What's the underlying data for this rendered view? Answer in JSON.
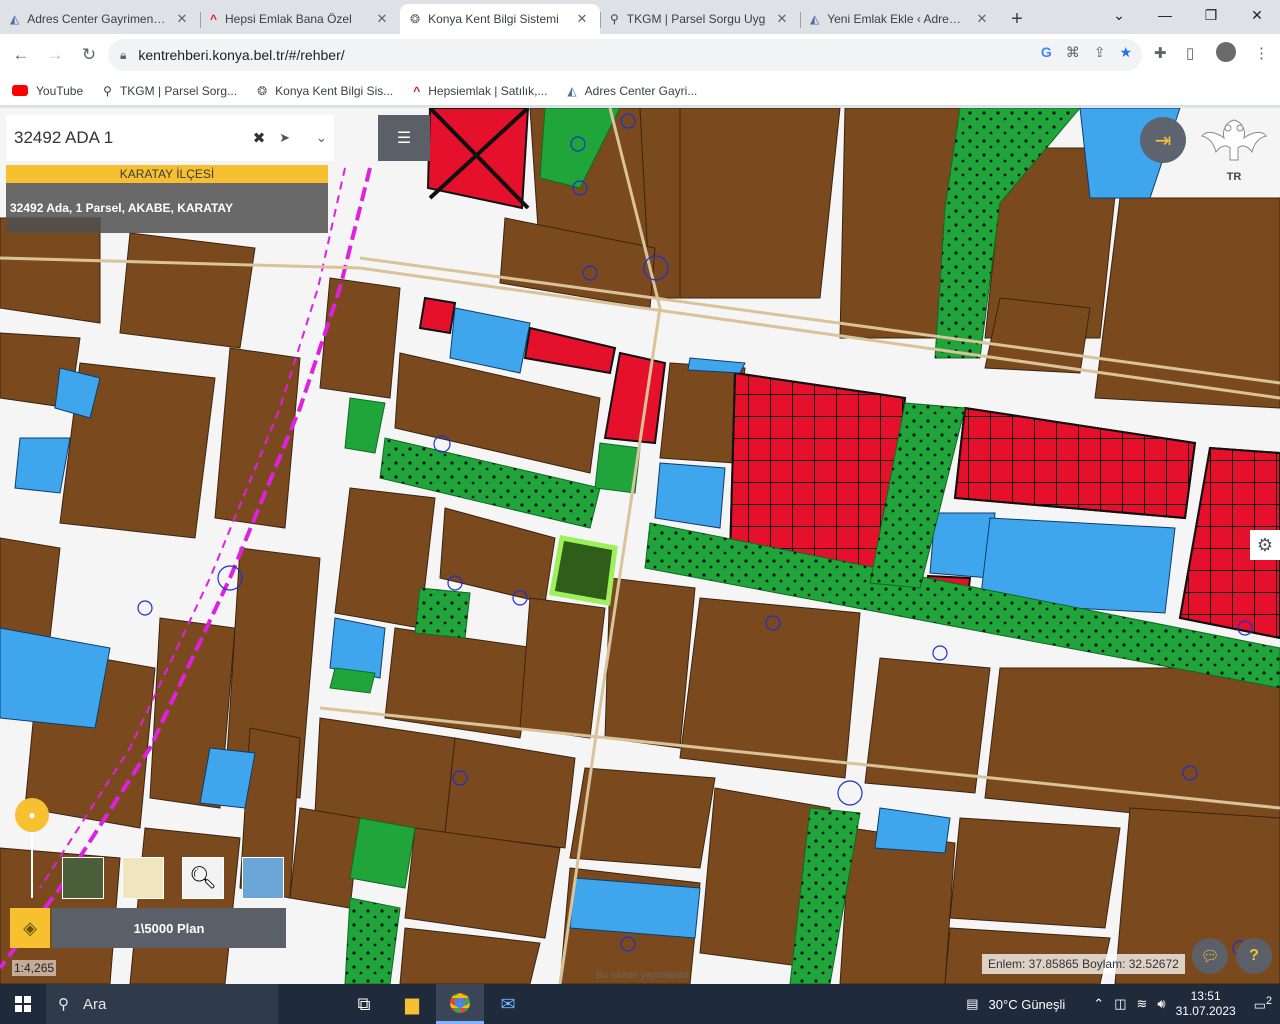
{
  "browser": {
    "tabs": [
      {
        "title": "Adres Center Gayrimenkul",
        "icon": "adres-logo-icon",
        "active": false
      },
      {
        "title": "Hepsi Emlak Bana Özel",
        "icon": "hepsiemlak-icon",
        "active": false
      },
      {
        "title": "Konya Kent Bilgi Sistemi",
        "icon": "konya-logo-icon",
        "active": true
      },
      {
        "title": "TKGM | Parsel Sorgu Uyg",
        "icon": "map-pin-icon",
        "active": false
      },
      {
        "title": "Yeni Emlak Ekle ‹ Adres Ce",
        "icon": "adres-logo-icon",
        "active": false
      }
    ],
    "url": "kentrehberi.konya.bel.tr/#/rehber/",
    "bookmarks": [
      {
        "label": "YouTube",
        "icon": "youtube-icon"
      },
      {
        "label": "TKGM | Parsel Sorg...",
        "icon": "map-pin-icon"
      },
      {
        "label": "Konya Kent Bilgi Sis...",
        "icon": "konya-logo-icon"
      },
      {
        "label": "Hepsiemlak | Satılık,...",
        "icon": "hepsiemlak-icon"
      },
      {
        "label": "Adres Center Gayri...",
        "icon": "adres-logo-icon"
      }
    ]
  },
  "map": {
    "search_value": "32492 ADA 1",
    "district": "KARATAY İLÇESİ",
    "parcel_info": "32492 Ada, 1 Parsel, AKABE, KARATAY",
    "plan_label": "1\\5000 Plan",
    "scale": "1:4,265",
    "coordinates": "Enlem: 37.85865 Boylam: 32.52672",
    "attribution": "Bu sitede yayınlanan",
    "logo_text": "TR"
  },
  "taskbar": {
    "search_placeholder": "Ara",
    "weather": "30°C  Güneşli",
    "time": "13:51",
    "date": "31.07.2023",
    "notifications": "2"
  },
  "colors": {
    "residential": "#7a4a1e",
    "commercial": "#e5112c",
    "park": "#1fa53a",
    "public": "#3fa6ee",
    "road": "#f6f6f6",
    "accent": "#f6c031"
  }
}
